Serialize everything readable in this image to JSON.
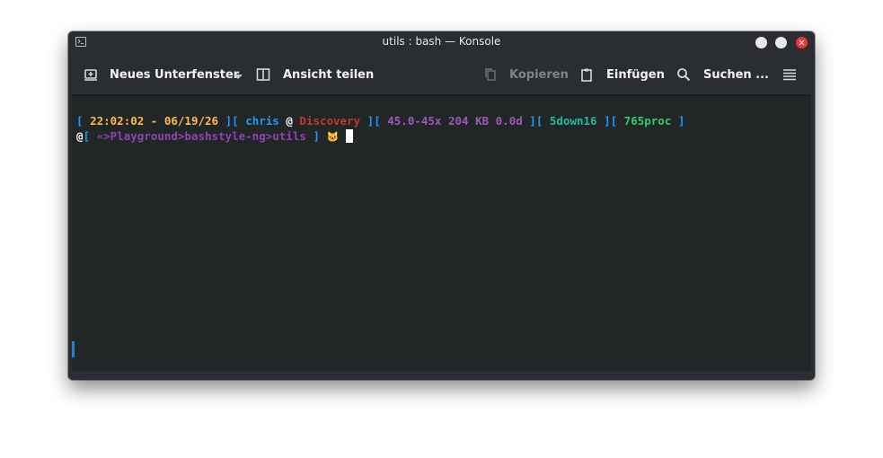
{
  "window": {
    "title": "utils : bash — Konsole"
  },
  "toolbar": {
    "new_tab_label": "Neues Unterfenster",
    "split_view_label": "Ansicht teilen",
    "copy_label": "Kopieren",
    "paste_label": "Einfügen",
    "search_label": "Suchen ..."
  },
  "prompt": {
    "bracket_open": "[ ",
    "time": "22:02:02",
    "dash": " - ",
    "date": "06/19/26",
    "sep1": " ][ ",
    "user": "chris",
    "at": " @ ",
    "host": "Discovery",
    "sep2": " ][ ",
    "load": "45.0-45x 204 KB 0.0d",
    "sep3": " ][ ",
    "net": "5down16",
    "sep4": " ][ ",
    "procs": "765proc",
    "bracket_close": " ]",
    "line2_at": "@",
    "line2_open": "[ ",
    "path": "«>Playground>bashstyle-ng>utils",
    "line2_close": " ] ",
    "emoji": "🐱"
  },
  "colors": {
    "window_bg": "#2a2e32",
    "terminal_bg": "#232627",
    "bracket": "#1d99f3",
    "time": "#fdbc4b",
    "user": "#1d99f3",
    "host": "#c0392b",
    "load": "#9b59b6",
    "net": "#1abc9c",
    "procs": "#2ecc71",
    "path": "#8e44ad",
    "close_button": "#ee3338"
  }
}
